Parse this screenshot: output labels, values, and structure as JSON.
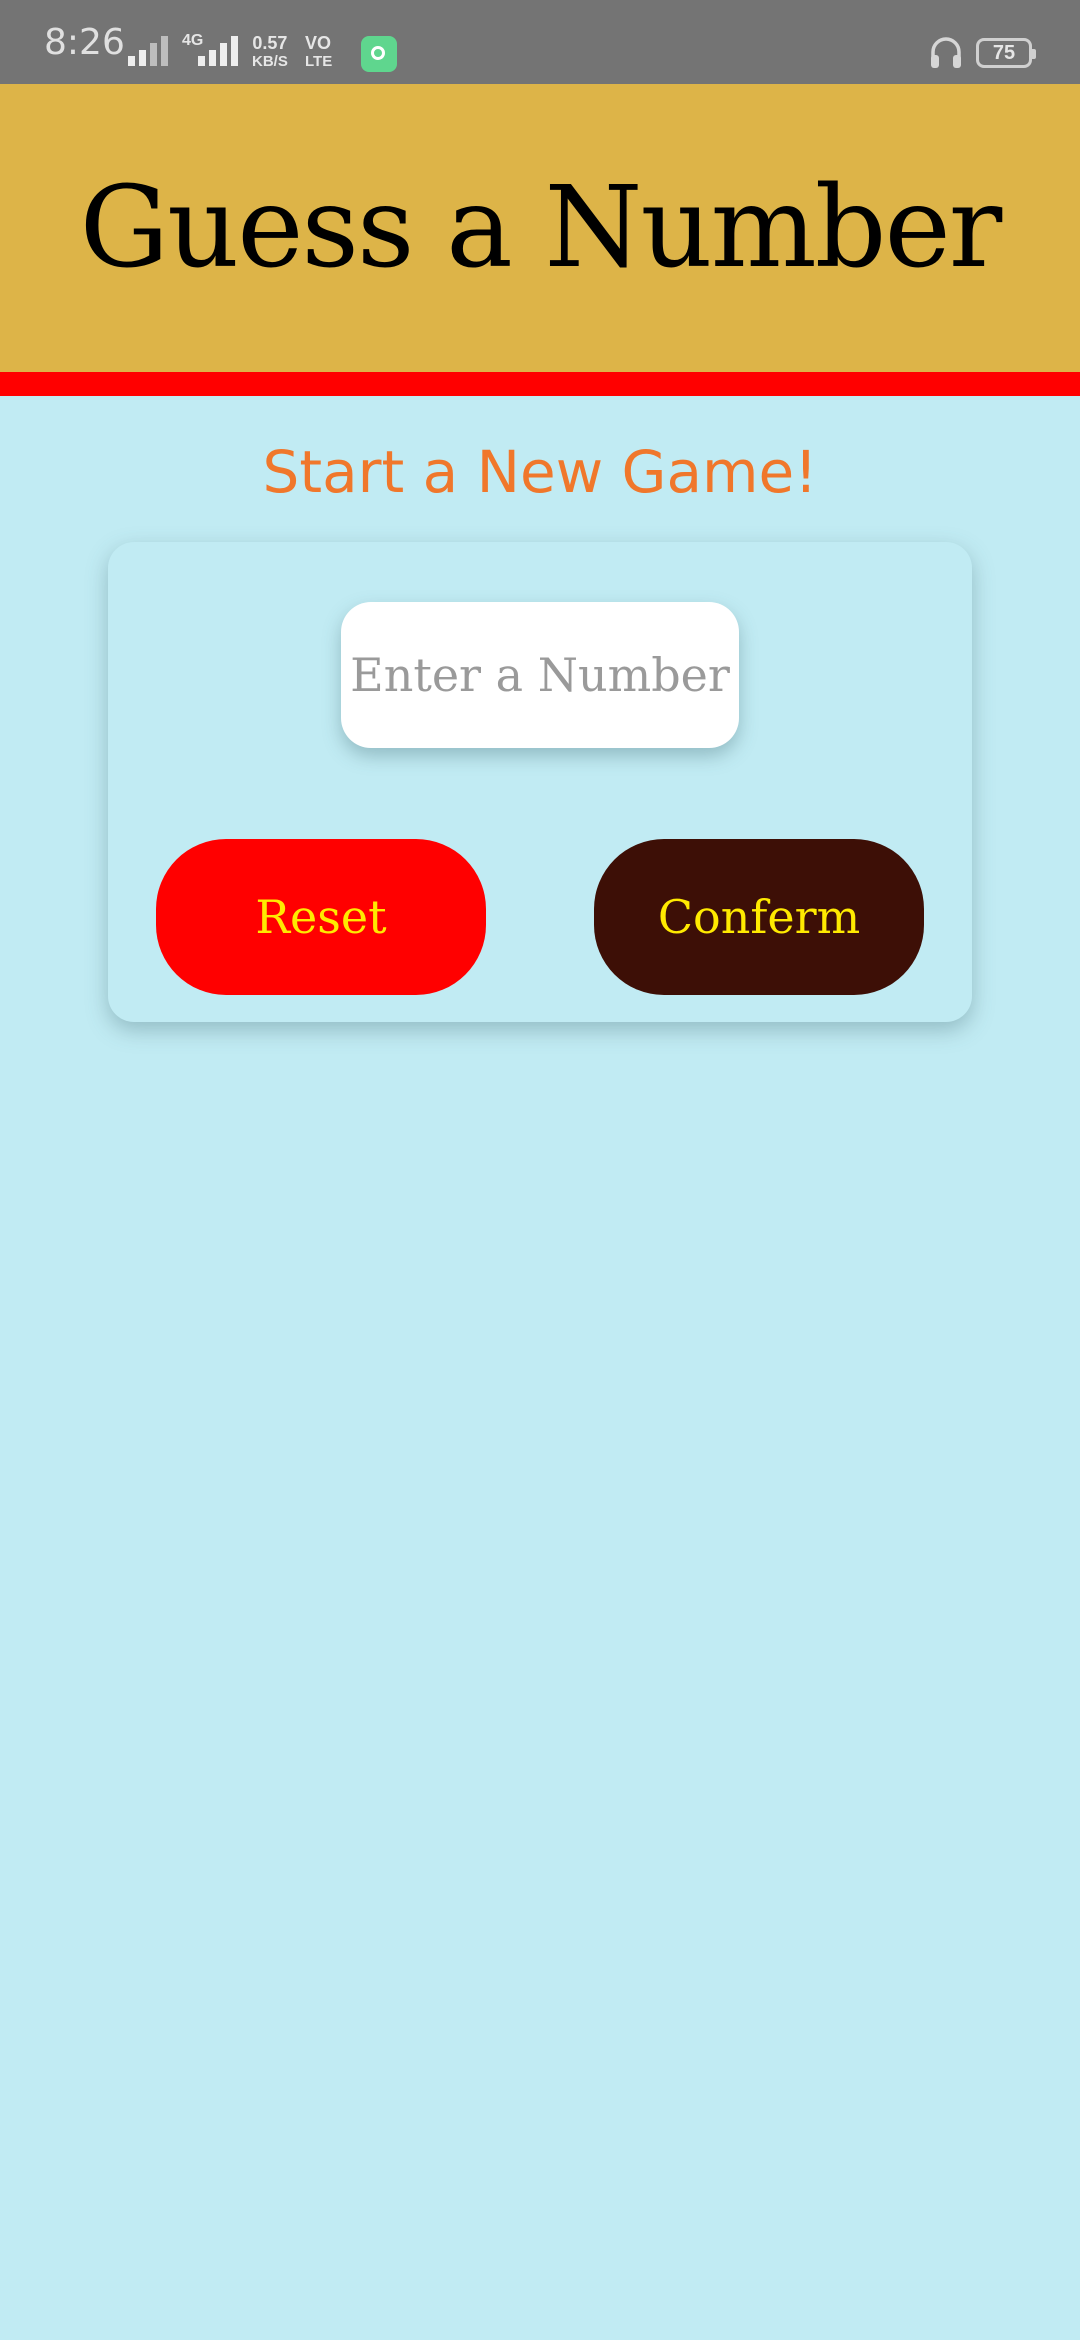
{
  "status_bar": {
    "time": "8:26",
    "network_type": "4G",
    "speed_value": "0.57",
    "speed_unit": "KB/S",
    "volte_top": "VO",
    "volte_bottom": "LTE",
    "battery_level": "75"
  },
  "header": {
    "title": "Guess a Number"
  },
  "main": {
    "subtitle": "Start a New Game!",
    "input_placeholder": "Enter a Number",
    "input_value": "",
    "reset_label": "Reset",
    "confirm_label": "Conferm"
  },
  "colors": {
    "status_bar": "#747474",
    "header_bg": "#ddb448",
    "header_stripe": "#ff0000",
    "page_bg": "#c1ebf3",
    "subtitle": "#f0772b",
    "reset_bg": "#ff0000",
    "confirm_bg": "#3d0f06",
    "button_text": "#ffea00"
  },
  "icons": {
    "signal_1": "signal-icon",
    "signal_2": "signal-icon",
    "app_notification": "chat-app-icon",
    "headphones": "headphone-icon",
    "battery": "battery-icon"
  }
}
